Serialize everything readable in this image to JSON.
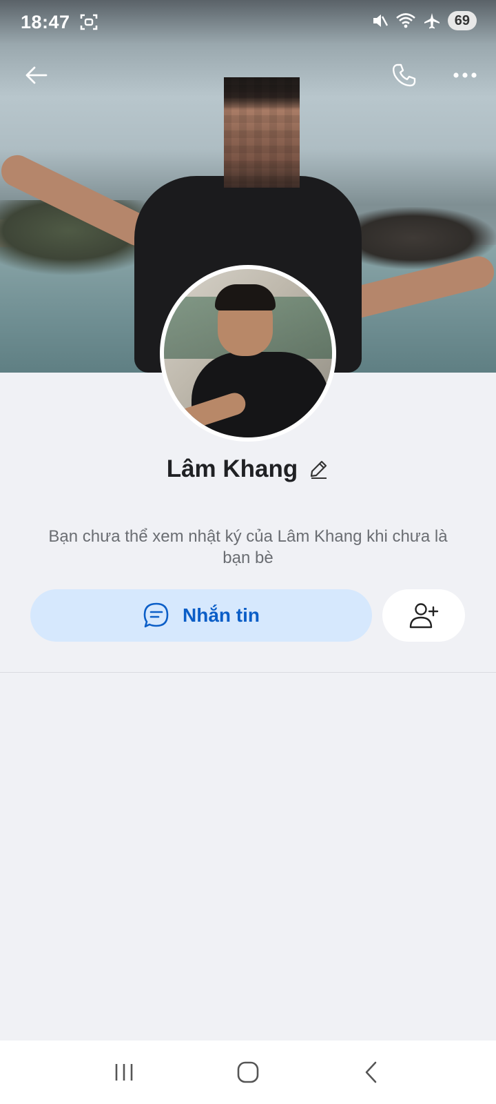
{
  "status_bar": {
    "time": "18:47",
    "battery": "69"
  },
  "profile": {
    "name": "Lâm Khang",
    "notice": "Bạn chưa thể xem nhật ký của Lâm Khang khi chưa là bạn bè"
  },
  "actions": {
    "message_label": "Nhắn tin"
  },
  "colors": {
    "accent": "#0b5ec7",
    "accent_bg": "#d6e8fd",
    "page_bg": "#f0f1f5"
  },
  "icons": {
    "back": "arrow-left-icon",
    "call": "phone-icon",
    "more": "more-horizontal-icon",
    "edit": "pencil-icon",
    "message": "chat-bubble-icon",
    "add_friend": "add-user-icon"
  }
}
